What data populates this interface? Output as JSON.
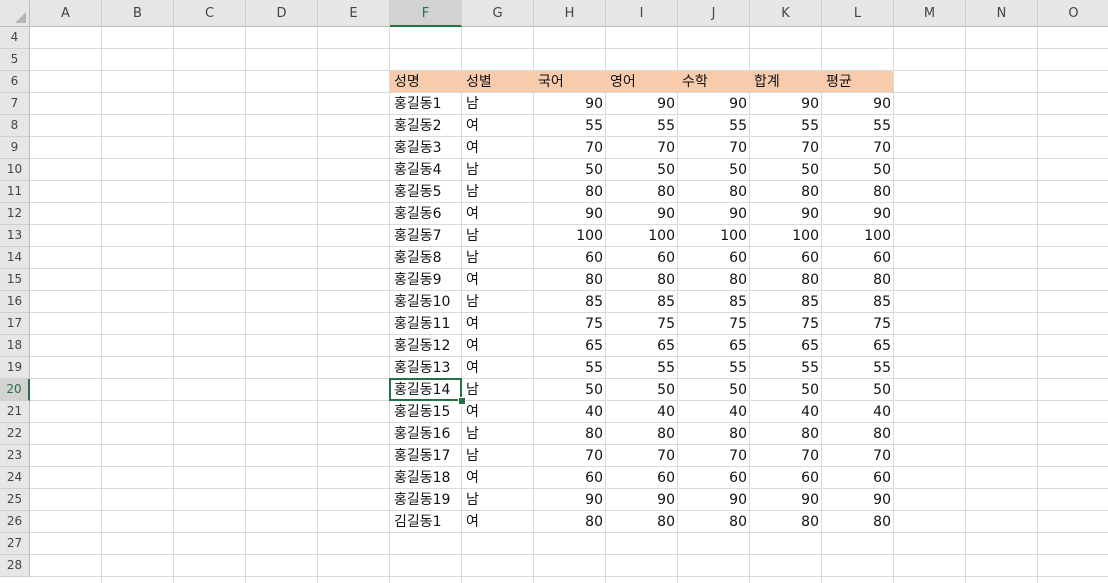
{
  "columns": [
    "A",
    "B",
    "C",
    "D",
    "E",
    "F",
    "G",
    "H",
    "I",
    "J",
    "K",
    "L",
    "M",
    "N",
    "O"
  ],
  "rows": [
    4,
    5,
    6,
    7,
    8,
    9,
    10,
    11,
    12,
    13,
    14,
    15,
    16,
    17,
    18,
    19,
    20,
    21,
    22,
    23,
    24,
    25,
    26,
    27,
    28
  ],
  "selected_column": "F",
  "selected_row": 20,
  "header_row": [
    "성명",
    "성별",
    "국어",
    "영어",
    "수학",
    "합계",
    "평균"
  ],
  "data_rows": [
    [
      "홍길동1",
      "남",
      "90",
      "90",
      "90",
      "90",
      "90"
    ],
    [
      "홍길동2",
      "여",
      "55",
      "55",
      "55",
      "55",
      "55"
    ],
    [
      "홍길동3",
      "여",
      "70",
      "70",
      "70",
      "70",
      "70"
    ],
    [
      "홍길동4",
      "남",
      "50",
      "50",
      "50",
      "50",
      "50"
    ],
    [
      "홍길동5",
      "남",
      "80",
      "80",
      "80",
      "80",
      "80"
    ],
    [
      "홍길동6",
      "여",
      "90",
      "90",
      "90",
      "90",
      "90"
    ],
    [
      "홍길동7",
      "남",
      "100",
      "100",
      "100",
      "100",
      "100"
    ],
    [
      "홍길동8",
      "남",
      "60",
      "60",
      "60",
      "60",
      "60"
    ],
    [
      "홍길동9",
      "여",
      "80",
      "80",
      "80",
      "80",
      "80"
    ],
    [
      "홍길동10",
      "남",
      "85",
      "85",
      "85",
      "85",
      "85"
    ],
    [
      "홍길동11",
      "여",
      "75",
      "75",
      "75",
      "75",
      "75"
    ],
    [
      "홍길동12",
      "여",
      "65",
      "65",
      "65",
      "65",
      "65"
    ],
    [
      "홍길동13",
      "여",
      "55",
      "55",
      "55",
      "55",
      "55"
    ],
    [
      "홍길동14",
      "남",
      "50",
      "50",
      "50",
      "50",
      "50"
    ],
    [
      "홍길동15",
      "여",
      "40",
      "40",
      "40",
      "40",
      "40"
    ],
    [
      "홍길동16",
      "남",
      "80",
      "80",
      "80",
      "80",
      "80"
    ],
    [
      "홍길동17",
      "남",
      "70",
      "70",
      "70",
      "70",
      "70"
    ],
    [
      "홍길동18",
      "여",
      "60",
      "60",
      "60",
      "60",
      "60"
    ],
    [
      "홍길동19",
      "남",
      "90",
      "90",
      "90",
      "90",
      "90"
    ],
    [
      "김길동1",
      "여",
      "80",
      "80",
      "80",
      "80",
      "80"
    ]
  ],
  "colors": {
    "header_fill": "#f8cbad",
    "selection": "#217346"
  }
}
